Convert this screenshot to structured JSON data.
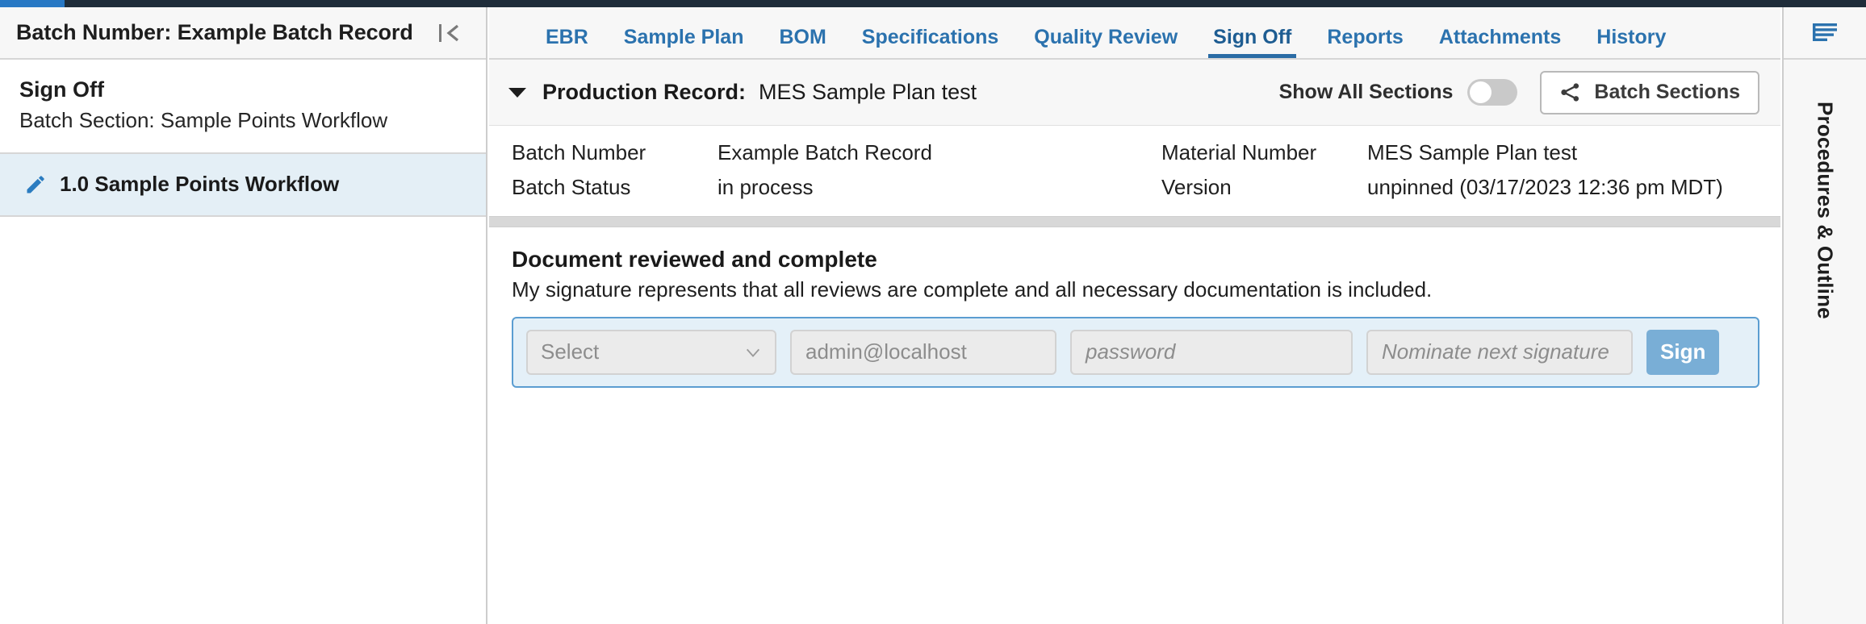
{
  "sidebar": {
    "header_title": "Batch Number: Example Batch Record",
    "collapse_icon": "collapse-left-icon",
    "section_title": "Sign Off",
    "section_subtitle": "Batch Section: Sample Points Workflow",
    "items": [
      {
        "icon": "pencil-icon",
        "label": "1.0 Sample Points Workflow"
      }
    ]
  },
  "nav": {
    "tabs": [
      {
        "label": "EBR",
        "active": false
      },
      {
        "label": "Sample Plan",
        "active": false
      },
      {
        "label": "BOM",
        "active": false
      },
      {
        "label": "Specifications",
        "active": false
      },
      {
        "label": "Quality Review",
        "active": false
      },
      {
        "label": "Sign Off",
        "active": true
      },
      {
        "label": "Reports",
        "active": false
      },
      {
        "label": "Attachments",
        "active": false
      },
      {
        "label": "History",
        "active": false
      }
    ]
  },
  "record_bar": {
    "caret_icon": "caret-down-icon",
    "label": "Production Record:",
    "value": "MES Sample Plan test",
    "toggle_label": "Show All Sections",
    "toggle_state": "off",
    "batch_sections_label": "Batch Sections",
    "batch_sections_icon": "share-icon"
  },
  "metadata": {
    "rows": [
      {
        "left_key": "Batch Number",
        "left_value": "Example Batch Record",
        "right_key": "Material Number",
        "right_value": "MES Sample Plan test"
      },
      {
        "left_key": "Batch Status",
        "left_value": "in process",
        "right_key": "Version",
        "right_value": "unpinned (03/17/2023 12:36 pm MDT)"
      }
    ]
  },
  "signoff": {
    "title": "Document reviewed and complete",
    "description": "My signature represents that all reviews are complete and all necessary documentation is included.",
    "select_placeholder": "Select",
    "select_icon": "chevron-down-icon",
    "email_placeholder": "admin@localhost",
    "password_placeholder": "password",
    "nominate_placeholder": "Nominate next signature",
    "sign_button_label": "Sign"
  },
  "rail": {
    "menu_icon": "list-menu-icon",
    "label": "Procedures & Outline"
  },
  "colors": {
    "accent_blue": "#2878c4",
    "tab_blue": "#2b72ae",
    "tab_active_blue": "#1e5d92",
    "panel_blue_bg": "#e4f0f8",
    "panel_blue_border": "#5b9dd1",
    "sign_button": "#79aed6",
    "sidebar_item_bg": "#e4eff6",
    "dark_strip": "#1f2d3a",
    "header_bg": "#f7f7f7"
  }
}
